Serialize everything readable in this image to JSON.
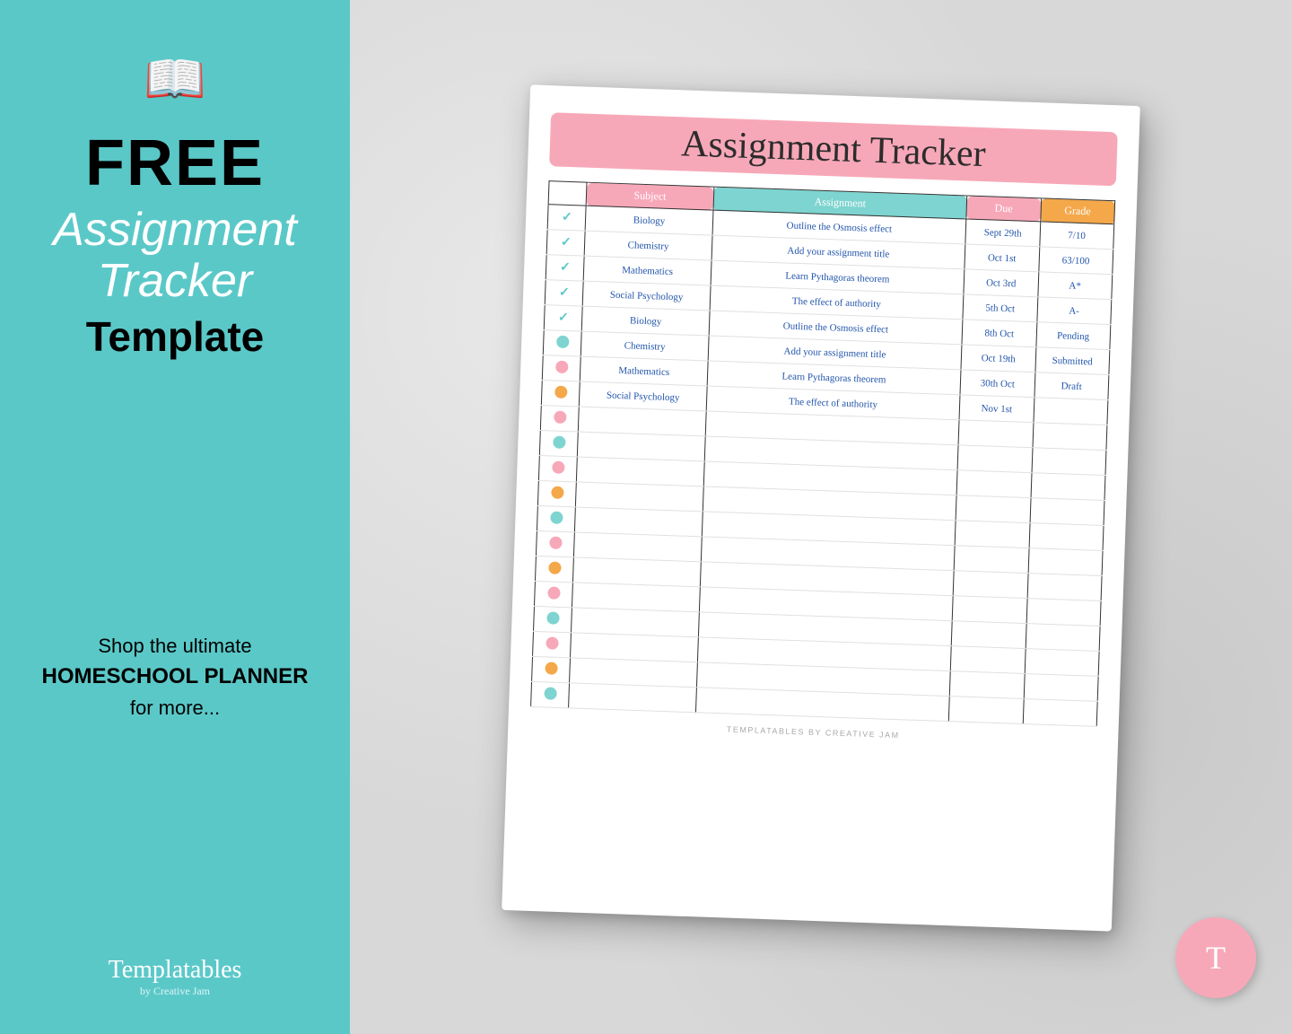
{
  "left": {
    "book_icon": "📖",
    "free_label": "FREE",
    "assignment_title": "Assignment\nTracker",
    "template_label": "Template",
    "shop_text_line1": "Shop the ultimate",
    "shop_text_line2": "HOMESCHOOL PLANNER",
    "shop_text_line3": "for more...",
    "brand_name": "Templatables",
    "brand_sub": "by Creative Jam"
  },
  "tracker": {
    "title": "Assignment Tracker",
    "headers": {
      "check": "✓",
      "subject": "Subject",
      "assignment": "Assignment",
      "due": "Due",
      "grade": "Grade"
    },
    "rows": [
      {
        "dot_type": "check",
        "subject": "Biology",
        "assignment": "Outline the Osmosis effect",
        "due": "Sept 29th",
        "grade": "7/10"
      },
      {
        "dot_type": "check",
        "subject": "Chemistry",
        "assignment": "Add your assignment title",
        "due": "Oct 1st",
        "grade": "63/100"
      },
      {
        "dot_type": "check",
        "subject": "Mathematics",
        "assignment": "Learn Pythagoras theorem",
        "due": "Oct 3rd",
        "grade": "A*"
      },
      {
        "dot_type": "check",
        "subject": "Social Psychology",
        "assignment": "The effect of authority",
        "due": "5th Oct",
        "grade": "A-"
      },
      {
        "dot_type": "check",
        "subject": "Biology",
        "assignment": "Outline the Osmosis effect",
        "due": "8th Oct",
        "grade": "Pending"
      },
      {
        "dot_type": "teal",
        "subject": "Chemistry",
        "assignment": "Add your assignment title",
        "due": "Oct 19th",
        "grade": "Submitted"
      },
      {
        "dot_type": "pink",
        "subject": "Mathematics",
        "assignment": "Learn Pythagoras theorem",
        "due": "30th Oct",
        "grade": "Draft"
      },
      {
        "dot_type": "orange",
        "subject": "Social Psychology",
        "assignment": "The effect of authority",
        "due": "Nov 1st",
        "grade": ""
      },
      {
        "dot_type": "pink",
        "subject": "",
        "assignment": "",
        "due": "",
        "grade": ""
      },
      {
        "dot_type": "teal",
        "subject": "",
        "assignment": "",
        "due": "",
        "grade": ""
      },
      {
        "dot_type": "pink",
        "subject": "",
        "assignment": "",
        "due": "",
        "grade": ""
      },
      {
        "dot_type": "orange",
        "subject": "",
        "assignment": "",
        "due": "",
        "grade": ""
      },
      {
        "dot_type": "teal",
        "subject": "",
        "assignment": "",
        "due": "",
        "grade": ""
      },
      {
        "dot_type": "pink",
        "subject": "",
        "assignment": "",
        "due": "",
        "grade": ""
      },
      {
        "dot_type": "orange",
        "subject": "",
        "assignment": "",
        "due": "",
        "grade": ""
      },
      {
        "dot_type": "pink",
        "subject": "",
        "assignment": "",
        "due": "",
        "grade": ""
      },
      {
        "dot_type": "teal",
        "subject": "",
        "assignment": "",
        "due": "",
        "grade": ""
      },
      {
        "dot_type": "pink",
        "subject": "",
        "assignment": "",
        "due": "",
        "grade": ""
      },
      {
        "dot_type": "orange",
        "subject": "",
        "assignment": "",
        "due": "",
        "grade": ""
      },
      {
        "dot_type": "teal",
        "subject": "",
        "assignment": "",
        "due": "",
        "grade": ""
      }
    ],
    "footer": "TEMPLATABLES BY CREATIVE JAM"
  },
  "badge": {
    "letter": "T"
  }
}
